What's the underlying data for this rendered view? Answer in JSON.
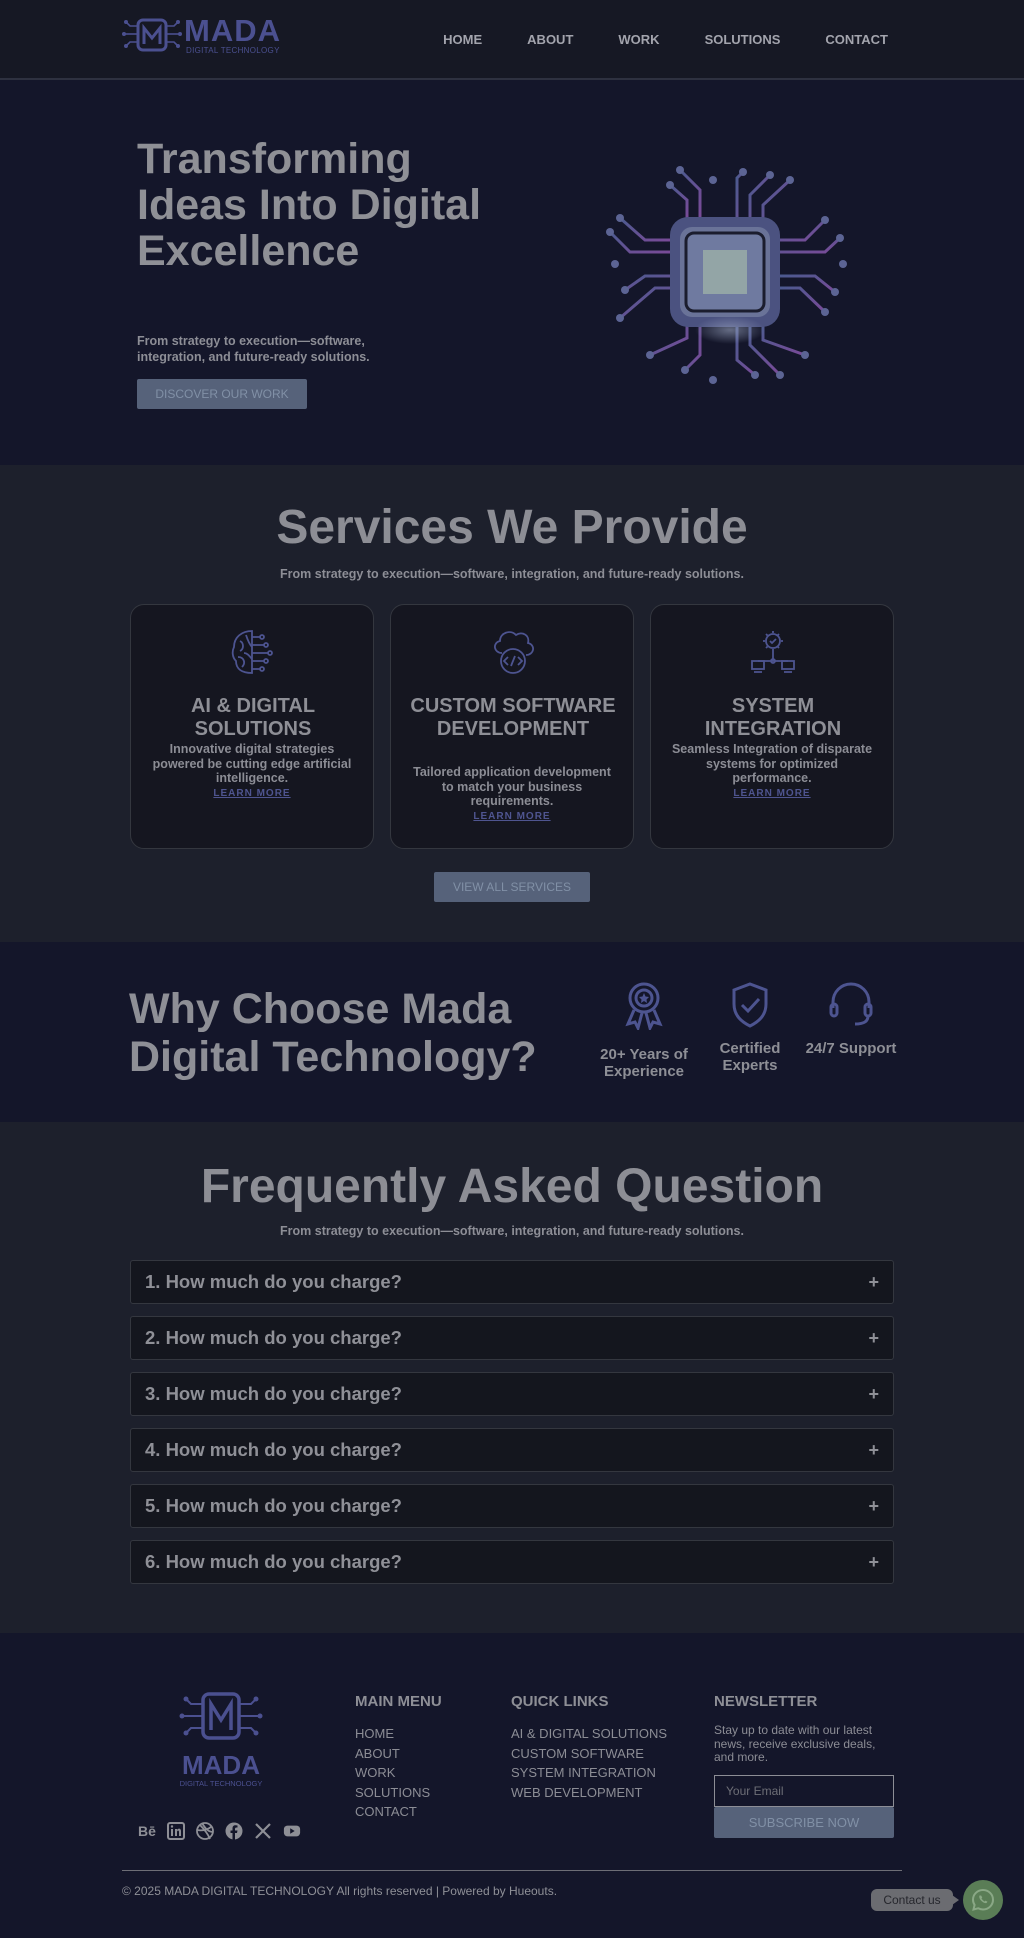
{
  "brand": {
    "name": "MADA",
    "tagline": "DIGITAL TECHNOLOGY"
  },
  "nav": {
    "items": [
      "HOME",
      "ABOUT",
      "WORK",
      "SOLUTIONS",
      "CONTACT"
    ]
  },
  "hero": {
    "title": "Transforming Ideas Into Digital Excellence",
    "subtitle": "From strategy to execution—software, integration, and future-ready solutions.",
    "cta": "DISCOVER OUR WORK"
  },
  "services": {
    "title": "Services We Provide",
    "subtitle": "From strategy to execution—software, integration, and future-ready solutions.",
    "cards": [
      {
        "icon": "ai-brain-icon",
        "title": "AI & DIGITAL SOLUTIONS",
        "desc": "Innovative digital strategies powered be cutting edge artificial intelligence.",
        "link": "LEARN MORE"
      },
      {
        "icon": "cloud-code-icon",
        "title": "CUSTOM SOFTWARE DEVELOPMENT",
        "desc": "Tailored application development to match your business requirements.",
        "link": "LEARN MORE"
      },
      {
        "icon": "system-integration-icon",
        "title": "SYSTEM INTEGRATION",
        "desc": "Seamless Integration of disparate systems for optimized performance.",
        "link": "LEARN MORE"
      }
    ],
    "cta": "VIEW ALL SERVICES"
  },
  "why": {
    "title": "Why Choose Mada Digital Technology?",
    "items": [
      {
        "icon": "award-medal-icon",
        "label": "20+ Years of Experience"
      },
      {
        "icon": "shield-check-icon",
        "label": "Certified Experts"
      },
      {
        "icon": "headset-icon",
        "label": "24/7 Support"
      }
    ]
  },
  "faq": {
    "title": "Frequently Asked Question",
    "subtitle": "From strategy to execution—software, integration, and future-ready solutions.",
    "items": [
      "1. How much do you charge?",
      "2. How much do you charge?",
      "3. How much do you charge?",
      "4. How much do you charge?",
      "5. How much do you charge?",
      "6. How much do you charge?"
    ],
    "toggle_symbol": "+"
  },
  "footer": {
    "social_icons": [
      "behance-icon",
      "linkedin-icon",
      "dribbble-icon",
      "facebook-icon",
      "x-icon",
      "youtube-icon"
    ],
    "main_menu": {
      "heading": "MAIN MENU",
      "links": [
        "HOME",
        "ABOUT",
        "WORK",
        "SOLUTIONS",
        "CONTACT"
      ]
    },
    "quick_links": {
      "heading": "QUICK LINKS",
      "links": [
        "AI & DIGITAL SOLUTIONS",
        "CUSTOM SOFTWARE",
        "SYSTEM INTEGRATION",
        "WEB DEVELOPMENT"
      ]
    },
    "newsletter": {
      "heading": "NEWSLETTER",
      "text": "Stay up to date with our latest news, receive exclusive deals, and more.",
      "placeholder": "Your Email",
      "button": "SUBSCRIBE NOW"
    },
    "copyright": "© 2025 MADA DIGITAL TECHNOLOGY All rights reserved | Powered by Hueouts."
  },
  "chat": {
    "label": "Contact us",
    "icon": "whatsapp-icon"
  },
  "colors": {
    "accent": "#4b5090",
    "button": "#56627a",
    "chat": "#5a7d56"
  }
}
